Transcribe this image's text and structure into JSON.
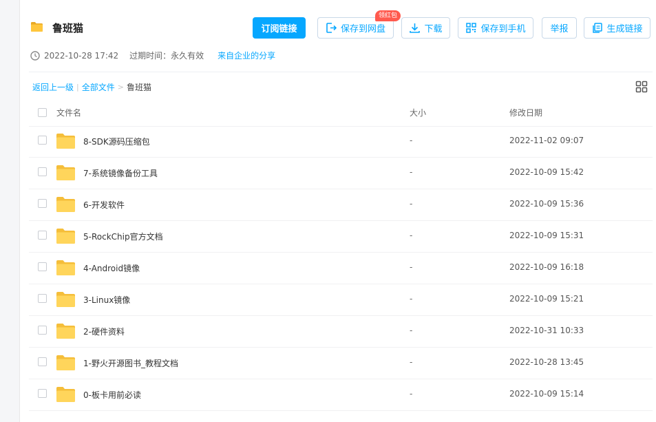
{
  "header": {
    "title": "鲁班猫",
    "buttons": {
      "subscribe": "订阅链接",
      "save_to_disk": "保存到网盘",
      "save_badge": "领红包",
      "download": "下载",
      "save_to_phone": "保存到手机",
      "report": "举报",
      "generate_link": "生成链接"
    },
    "share_date": "2022-10-28 17:42",
    "expire": "过期时间：永久有效",
    "share_from": "来自企业的分享"
  },
  "breadcrumb": {
    "back": "返回上一级",
    "all_files": "全部文件",
    "current": "鲁班猫"
  },
  "table": {
    "columns": {
      "name": "文件名",
      "size": "大小",
      "date": "修改日期"
    },
    "rows": [
      {
        "name": "8-SDK源码压缩包",
        "size": "-",
        "date": "2022-11-02 09:07"
      },
      {
        "name": "7-系统镜像备份工具",
        "size": "-",
        "date": "2022-10-09 15:42"
      },
      {
        "name": "6-开发软件",
        "size": "-",
        "date": "2022-10-09 15:36"
      },
      {
        "name": "5-RockChip官方文档",
        "size": "-",
        "date": "2022-10-09 15:31"
      },
      {
        "name": "4-Android镜像",
        "size": "-",
        "date": "2022-10-09 16:18"
      },
      {
        "name": "3-Linux镜像",
        "size": "-",
        "date": "2022-10-09 15:21"
      },
      {
        "name": "2-硬件资料",
        "size": "-",
        "date": "2022-10-31 10:33"
      },
      {
        "name": "1-野火开源图书_教程文档",
        "size": "-",
        "date": "2022-10-28 13:45"
      },
      {
        "name": "0-板卡用前必读",
        "size": "-",
        "date": "2022-10-09 15:14"
      }
    ]
  },
  "colors": {
    "accent": "#06a7ff",
    "badge": "#ff5a4e",
    "folder": "#ffd55b"
  }
}
